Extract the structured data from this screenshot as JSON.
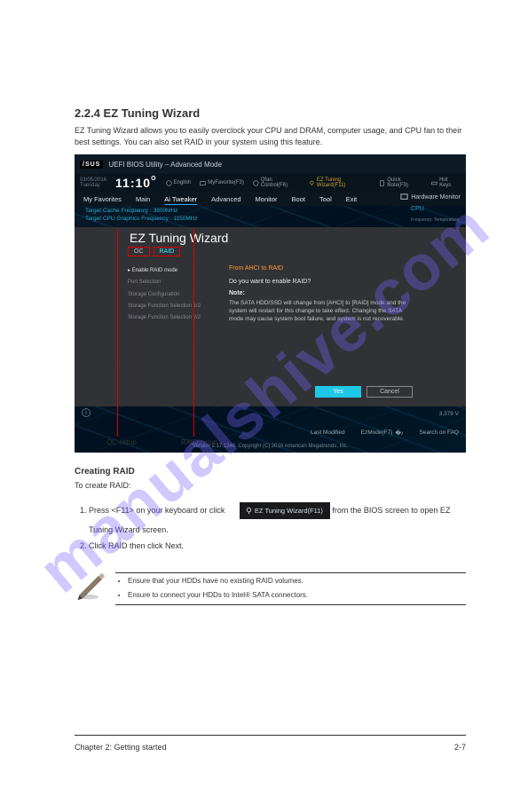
{
  "page": {
    "section_title": "2.2.4  EZ Tuning Wizard",
    "section_desc": "EZ Tuning Wizard allows you to easily overclock your CPU and DRAM, computer usage, and CPU fan to their best settings. You can also set RAID in your system using this feature.",
    "callout_raid": "RAID setup",
    "callout_oc": "OC setup",
    "config_title": "Creating RAID",
    "config_intro": "To create RAID:",
    "steps": [
      "Press <F11> on your keyboard or click                                      from the BIOS screen to open EZ Tuning Wizard screen.",
      "Click RAID then click Next.",
      "",
      ""
    ],
    "ez_button": "EZ Tuning Wizard(F11)",
    "notes": [
      "Ensure that your HDDs have no existing RAID volumes.",
      "Ensure to connect your HDDs to Intel® SATA connectors."
    ],
    "chapter": "Chapter 2: Getting started",
    "page_no": "2-7",
    "watermark": "manualshive.com"
  },
  "bios": {
    "utility_title": "UEFI BIOS Utility – Advanced Mode",
    "date": "03/05/2016",
    "day": "Tuesday",
    "time": "11:10",
    "deg": "O",
    "top_links": {
      "lang": "English",
      "myfav": "MyFavorite(F3)",
      "qfan": "Qfan Control(F6)",
      "ezwiz": "EZ Tuning Wizard(F11)",
      "qnote": "Quick Note(F9)",
      "hotkeys": "Hot Keys"
    },
    "tabs": [
      "My Favorites",
      "Main",
      "Ai Tweaker",
      "Advanced",
      "Monitor",
      "Boot",
      "Tool",
      "Exit"
    ],
    "hw_monitor": "Hardware Monitor",
    "freq1": "Target Cache Frequency : 3800MHz",
    "freq2": "Target CPU Graphics Frequency : 1150MHz",
    "cpu_label": "CPU",
    "cpu_freq": "Frequency",
    "cpu_temp": "Temperature",
    "voltage": "3.379 V",
    "footer": {
      "last_mod": "Last Modified",
      "ezmode": "EzMode(F7)",
      "search": "Search on FAQ"
    },
    "copyright": "Version 2.17.1246. Copyright (C) 2016 American Megatrends, Inc."
  },
  "wizard": {
    "title": "EZ Tuning Wizard",
    "tab_oc": "OC",
    "tab_raid": "RAID",
    "left_items": [
      "Enable RAID mode",
      "Port Selection",
      "Storage Configuration",
      "Storage Function Selection 1/2",
      "Storage Function Selection 2/2"
    ],
    "right_heading": "From AHCI to RAID",
    "question": "Do you want to enable RAID?",
    "note_label": "Note:",
    "note_text": "The SATA HDD/SSD will change from [AHCI] to [RAID] mode and the system will restart for this change to take effect. Changing the SATA mode may cause system boot failure, and system is not recoverable.",
    "btn_yes": "Yes",
    "btn_cancel": "Cancel"
  }
}
